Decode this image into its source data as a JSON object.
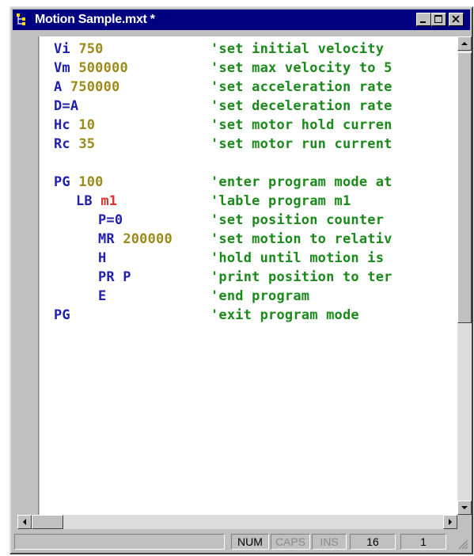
{
  "window": {
    "title": "Motion Sample.mxt *"
  },
  "code_lines": [
    {
      "indent": 0,
      "tokens": [
        {
          "t": "Vi ",
          "c": "kw"
        },
        {
          "t": "750",
          "c": "num"
        }
      ],
      "comment": "'set initial velocity"
    },
    {
      "indent": 0,
      "tokens": [
        {
          "t": "Vm ",
          "c": "kw"
        },
        {
          "t": "500000",
          "c": "num"
        }
      ],
      "comment": "'set max velocity to 5"
    },
    {
      "indent": 0,
      "tokens": [
        {
          "t": "A ",
          "c": "kw"
        },
        {
          "t": "750000",
          "c": "num"
        }
      ],
      "comment": "'set acceleration rate"
    },
    {
      "indent": 0,
      "tokens": [
        {
          "t": "D=A",
          "c": "kw"
        }
      ],
      "comment": "'set deceleration rate"
    },
    {
      "indent": 0,
      "tokens": [
        {
          "t": "Hc ",
          "c": "kw"
        },
        {
          "t": "10",
          "c": "num"
        }
      ],
      "comment": "'set motor hold curren"
    },
    {
      "indent": 0,
      "tokens": [
        {
          "t": "Rc ",
          "c": "kw"
        },
        {
          "t": "35",
          "c": "num"
        }
      ],
      "comment": "'set motor run current"
    },
    {
      "indent": 0,
      "tokens": [],
      "comment": ""
    },
    {
      "indent": 0,
      "tokens": [
        {
          "t": "PG ",
          "c": "kw"
        },
        {
          "t": "100",
          "c": "num"
        }
      ],
      "comment": "'enter program mode at"
    },
    {
      "indent": 1,
      "tokens": [
        {
          "t": "LB ",
          "c": "kw"
        },
        {
          "t": "m1",
          "c": "lbl"
        }
      ],
      "comment": "'lable program m1"
    },
    {
      "indent": 2,
      "tokens": [
        {
          "t": "P=0",
          "c": "kw"
        }
      ],
      "comment": "'set position counter"
    },
    {
      "indent": 2,
      "tokens": [
        {
          "t": "MR ",
          "c": "kw"
        },
        {
          "t": "200000",
          "c": "num"
        }
      ],
      "comment": "'set motion to relativ"
    },
    {
      "indent": 2,
      "tokens": [
        {
          "t": "H",
          "c": "kw"
        }
      ],
      "comment": "'hold until motion is"
    },
    {
      "indent": 2,
      "tokens": [
        {
          "t": "PR P",
          "c": "kw"
        }
      ],
      "comment": "'print position to ter"
    },
    {
      "indent": 2,
      "tokens": [
        {
          "t": "E",
          "c": "kw"
        }
      ],
      "comment": "'end program"
    },
    {
      "indent": 0,
      "tokens": [
        {
          "t": "PG",
          "c": "kw"
        }
      ],
      "comment": "'exit program mode"
    }
  ],
  "status": {
    "num": "NUM",
    "caps": "CAPS",
    "ins": "INS",
    "line": "16",
    "col": "1"
  },
  "colors": {
    "keyword": "#1f1fb0",
    "number": "#9c8a1a",
    "label": "#e03030",
    "comment": "#1a8a1a",
    "titlebar": "#000080"
  },
  "icons": {
    "window_icon": "tree-app-icon",
    "minimize": "minimize-icon",
    "maximize": "maximize-icon",
    "close": "close-icon",
    "scroll_up": "arrow-up-icon",
    "scroll_down": "arrow-down-icon",
    "scroll_left": "arrow-left-icon",
    "scroll_right": "arrow-right-icon",
    "resize_grip": "resize-grip-icon"
  }
}
